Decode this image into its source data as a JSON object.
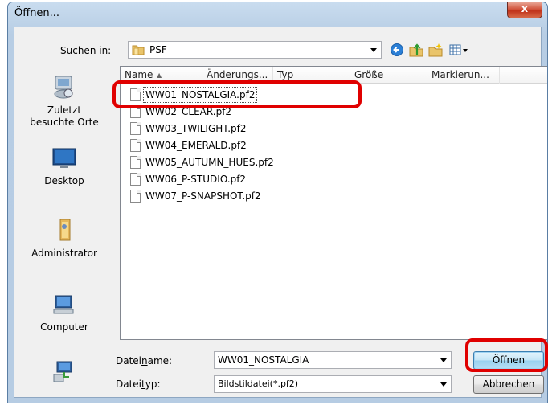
{
  "window": {
    "title": "Öffnen...",
    "close_glyph": "x"
  },
  "toolbar": {
    "lookin_label_prefix": "S",
    "lookin_label_rest": "uchen in:",
    "lookin_value": "PSF",
    "tools": [
      "back-icon",
      "up-folder-icon",
      "new-folder-icon",
      "view-menu-icon"
    ]
  },
  "places": [
    {
      "label": "Zuletzt\nbesuchte Orte",
      "icon": "recent-places-icon"
    },
    {
      "label": "Desktop",
      "icon": "desktop-icon"
    },
    {
      "label": "Administrator",
      "icon": "user-folder-icon"
    },
    {
      "label": "Computer",
      "icon": "computer-icon"
    },
    {
      "label": "",
      "icon": "network-icon"
    }
  ],
  "columns": [
    "Name",
    "Änderungs...",
    "Typ",
    "Größe",
    "Markierun..."
  ],
  "files": [
    "WW01_NOSTALGIA.pf2",
    "WW02_CLEAR.pf2",
    "WW03_TWILIGHT.pf2",
    "WW04_EMERALD.pf2",
    "WW05_AUTUMN_HUES.pf2",
    "WW06_P-STUDIO.pf2",
    "WW07_P-SNAPSHOT.pf2"
  ],
  "selected_index": 0,
  "filename": {
    "label_pre": "Datei",
    "label_u": "n",
    "label_post": "ame:",
    "value": "WW01_NOSTALGIA"
  },
  "filetype": {
    "label_pre": "Datei",
    "label_u": "t",
    "label_post": "yp:",
    "value": "Bildstildatei(*.pf2)"
  },
  "buttons": {
    "open": "Öffnen",
    "cancel": "Abbrechen"
  },
  "colors": {
    "highlight": "#e00000"
  }
}
